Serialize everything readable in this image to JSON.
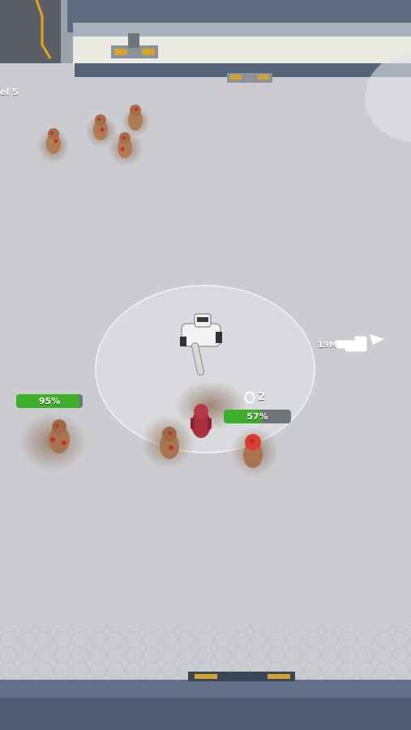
{
  "hud": {
    "level_label": "el 5",
    "distance_label": "19M",
    "kill_count": "2",
    "bars": [
      {
        "label": "95%",
        "value": 95
      },
      {
        "label": "57%",
        "value": 57
      }
    ]
  },
  "colors": {
    "floor": "#cbccd0",
    "wall": "#5d6b80",
    "health_green": "#3fae2a",
    "zombie": "#b2794c",
    "player": "#a8303f"
  },
  "icons": [
    "pointing-hand-icon",
    "arrow-icon",
    "hexagon-icon"
  ]
}
